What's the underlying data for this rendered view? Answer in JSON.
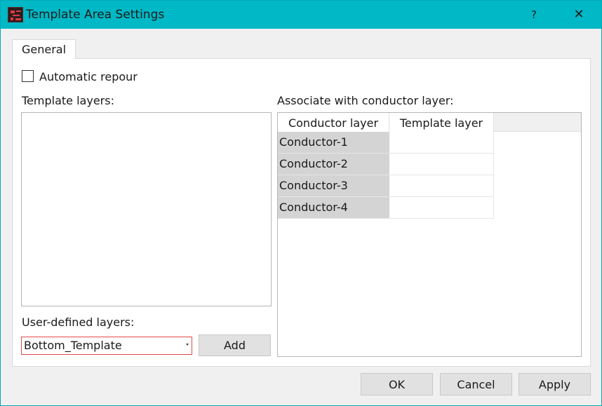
{
  "window": {
    "title": "Template Area Settings",
    "help_glyph": "?",
    "close_glyph": "✕",
    "icon": "app-logo-icon"
  },
  "tabs": [
    {
      "label": "General",
      "active": true
    }
  ],
  "general": {
    "automatic_repour": {
      "label": "Automatic repour",
      "checked": false
    },
    "template_layers_label": "Template layers:",
    "template_layers_items": [],
    "user_defined_layers_label": "User-defined layers:",
    "user_defined_layers_value": "Bottom_Template",
    "add_label": "Add",
    "associate_label": "Associate with conductor layer:",
    "table": {
      "columns": [
        "Conductor layer",
        "Template layer"
      ],
      "rows": [
        {
          "conductor": "Conductor-1",
          "template": ""
        },
        {
          "conductor": "Conductor-2",
          "template": ""
        },
        {
          "conductor": "Conductor-3",
          "template": ""
        },
        {
          "conductor": "Conductor-4",
          "template": ""
        }
      ]
    }
  },
  "footer": {
    "ok_label": "OK",
    "cancel_label": "Cancel",
    "apply_label": "Apply"
  },
  "colors": {
    "titlebar": "#00b8c6",
    "accent_error": "#e24a4a",
    "row_header": "#d4d4d4"
  }
}
